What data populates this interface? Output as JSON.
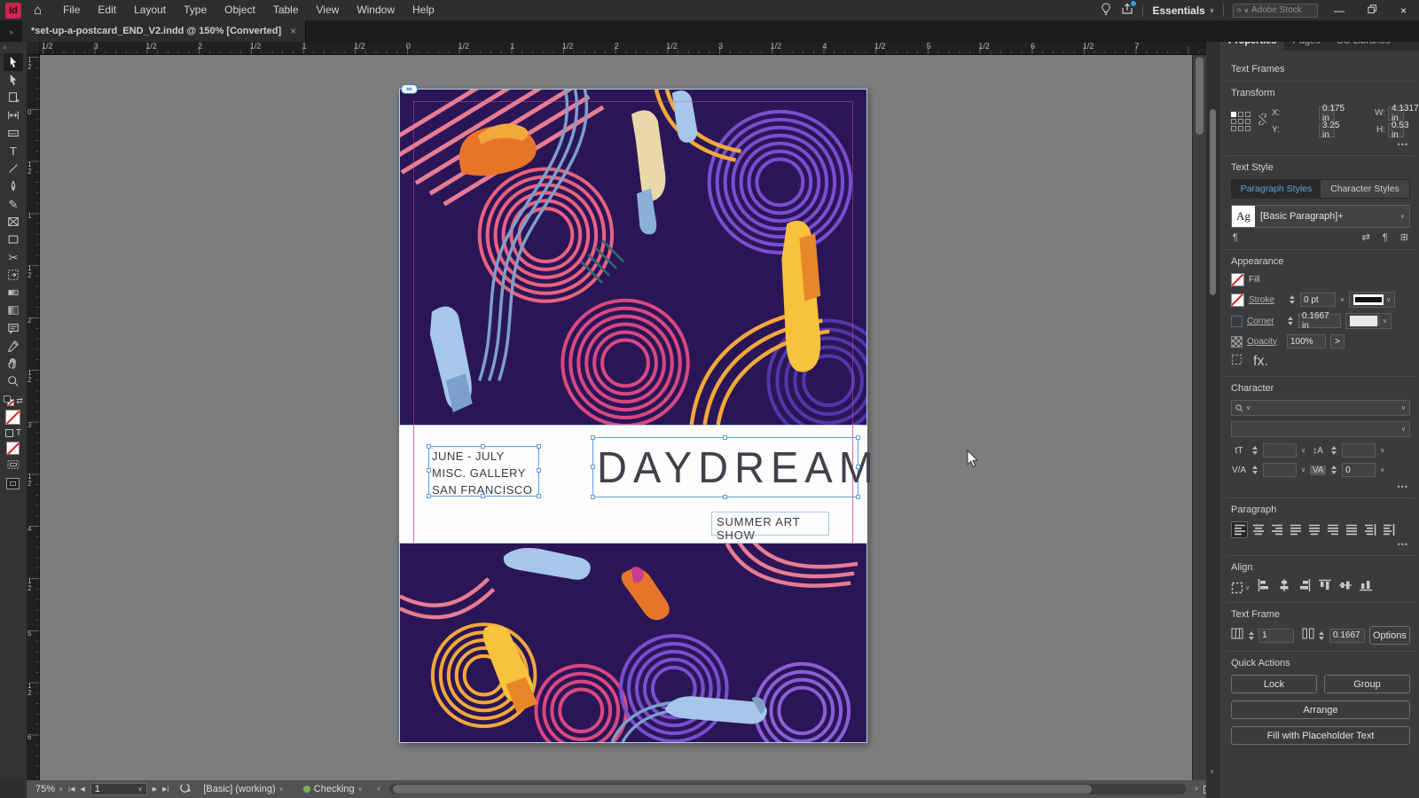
{
  "app": {
    "logo": "Id"
  },
  "icons": {
    "home": "⌂",
    "chevron_down": "∨",
    "chevron_up": "∧",
    "close": "×",
    "minimize": "—",
    "more": "•••",
    "pilcrow": "¶",
    "plus_box": "⊞",
    "swap": "⇄",
    "infinity": "∞",
    "type_tool": "T",
    "scissors": "✂",
    "pencil": "✎",
    "fx": "fx.",
    "prev": "◀",
    "next": "▶",
    "first": "|◀",
    "last": "▶|",
    "arrow_left": "<",
    "arrow_right": ">",
    "size_icon": "tT",
    "leading_icon": "↕A",
    "kern_icon": "V/A",
    "track_icon": "VA",
    "panel_expand": "»"
  },
  "menubar": {
    "menus": [
      "File",
      "Edit",
      "Layout",
      "Type",
      "Object",
      "Table",
      "View",
      "Window",
      "Help"
    ],
    "workspace_label": "Essentials",
    "search_placeholder": "Adobe Stock"
  },
  "document_tab": {
    "title": "*set-up-a-postcard_END_V2.indd @ 150% [Converted]"
  },
  "rulers": {
    "horizontal": [
      "1/2",
      "3",
      "1/2",
      "2",
      "1/2",
      "1",
      "1/2",
      "0",
      "1/2",
      "1",
      "1/2",
      "2",
      "1/2",
      "3",
      "1/2",
      "4",
      "1/2",
      "5",
      "1/2",
      "6",
      "1/2",
      "7"
    ],
    "vertical": [
      "1/2",
      "0",
      "1/2",
      "1",
      "1/2",
      "2",
      "1/2",
      "3",
      "1/2",
      "4",
      "1/2",
      "5",
      "1/2",
      "6"
    ]
  },
  "toolbar": {
    "tools": [
      "selection",
      "direct-selection",
      "page",
      "gap",
      "content-collector",
      "type",
      "line",
      "pen",
      "pencil",
      "rectangle-frame",
      "rectangle",
      "scissors",
      "free-transform",
      "gradient-swatch",
      "gradient-feather",
      "note",
      "color-theme",
      "hand",
      "zoom"
    ],
    "active_tool": "selection"
  },
  "artwork": {
    "dates_line1": "JUNE - JULY",
    "dates_line2": "MISC. GALLERY",
    "dates_line3": "SAN FRANCISCO",
    "title": "DAYDREAM",
    "subtitle": "SUMMER ART SHOW"
  },
  "panel": {
    "tabs": {
      "properties": "Properties",
      "pages": "Pages",
      "cc_libraries": "CC Libraries"
    },
    "selection_type": "Text Frames",
    "transform": {
      "title": "Transform",
      "x_label": "X:",
      "x": "0.175 in",
      "y_label": "Y:",
      "y": "3.25 in",
      "w_label": "W:",
      "w": "4.1317 in",
      "h_label": "H:",
      "h": "0.53 in"
    },
    "text_style": {
      "title": "Text Style",
      "tab_paragraph": "Paragraph Styles",
      "tab_character": "Character Styles",
      "preview": "Ag",
      "style_name": "[Basic Paragraph]+"
    },
    "appearance": {
      "title": "Appearance",
      "fill": "Fill",
      "stroke": "Stroke",
      "stroke_weight": "0 pt",
      "corner": "Corner",
      "corner_radius": "0.1667 in",
      "opacity": "Opacity",
      "opacity_value": "100%"
    },
    "character": {
      "title": "Character",
      "font_value": "",
      "style_value": "",
      "size_value": "",
      "leading_value": "",
      "kerning_value": "",
      "tracking_value": "0"
    },
    "paragraph": {
      "title": "Paragraph"
    },
    "align": {
      "title": "Align"
    },
    "text_frame": {
      "title": "Text Frame",
      "columns": "1",
      "gutter": "0.1667",
      "options": "Options"
    },
    "quick_actions": {
      "title": "Quick Actions",
      "lock": "Lock",
      "group": "Group",
      "arrange": "Arrange",
      "fill_placeholder": "Fill with Placeholder Text"
    }
  },
  "statusbar": {
    "zoom": "75%",
    "page": "1",
    "workflow": "[Basic] (working)",
    "preflight": "Checking"
  },
  "colors": {
    "accent_blue": "#4f9fd8",
    "selection_blue": "#5f9fdf",
    "guide_magenta": "#d8569e",
    "art_navy": "#2a1657",
    "status_green": "#79b34f",
    "logo_red": "#c9254d"
  }
}
